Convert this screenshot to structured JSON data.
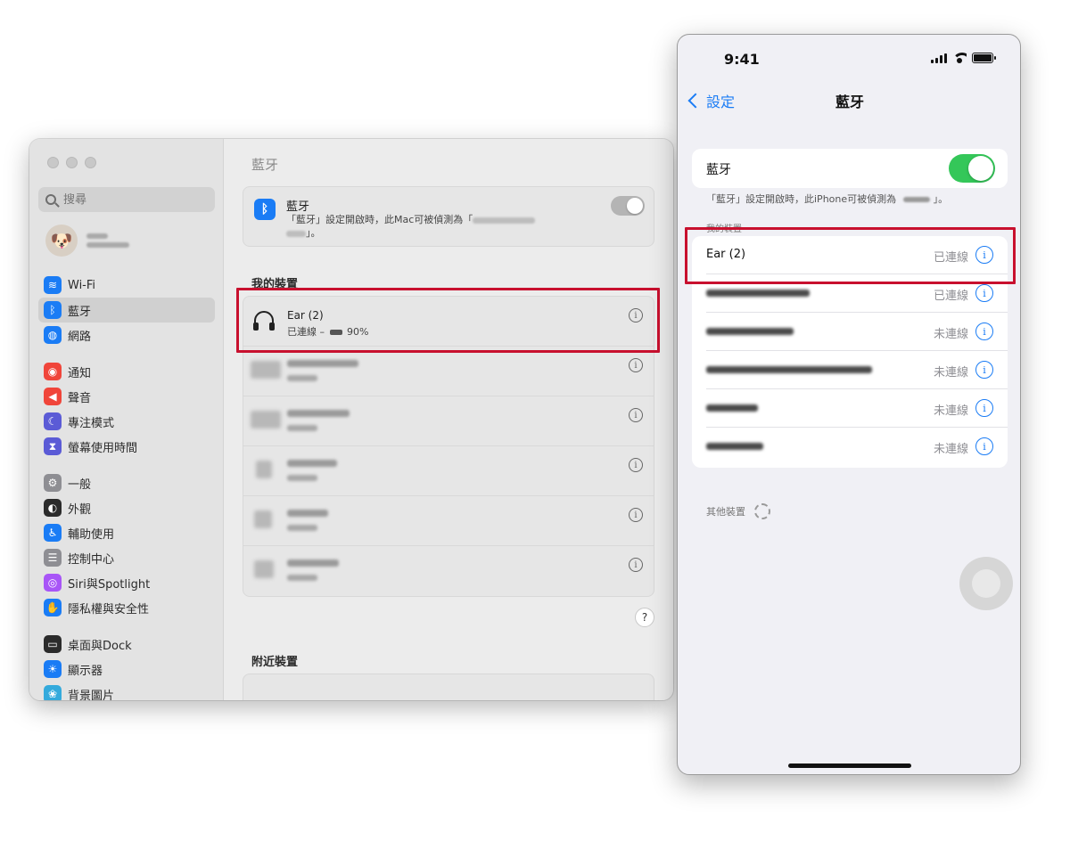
{
  "mac": {
    "search_placeholder": "搜尋",
    "sidebar": [
      {
        "label": "Wi-Fi",
        "color": "#1a7cf5",
        "glyph": "≋"
      },
      {
        "label": "藍牙",
        "color": "#1a7cf5",
        "glyph": "ᛒ",
        "active": true
      },
      {
        "label": "網路",
        "color": "#1a7cf5",
        "glyph": "◍"
      },
      {
        "label": "通知",
        "color": "#f0453a",
        "glyph": "◉"
      },
      {
        "label": "聲音",
        "color": "#f0453a",
        "glyph": "◀"
      },
      {
        "label": "專注模式",
        "color": "#5b5bd6",
        "glyph": "☾"
      },
      {
        "label": "螢幕使用時間",
        "color": "#5b5bd6",
        "glyph": "⧗"
      },
      {
        "label": "一般",
        "color": "#8e8e93",
        "glyph": "⚙"
      },
      {
        "label": "外觀",
        "color": "#2b2b2b",
        "glyph": "◐"
      },
      {
        "label": "輔助使用",
        "color": "#1a7cf5",
        "glyph": "♿"
      },
      {
        "label": "控制中心",
        "color": "#8e8e93",
        "glyph": "☰"
      },
      {
        "label": "Siri與Spotlight",
        "color": "#a855f7",
        "glyph": "◎"
      },
      {
        "label": "隱私權與安全性",
        "color": "#1a7cf5",
        "glyph": "✋"
      },
      {
        "label": "桌面與Dock",
        "color": "#2b2b2b",
        "glyph": "▭"
      },
      {
        "label": "顯示器",
        "color": "#1a7cf5",
        "glyph": "☀"
      },
      {
        "label": "背景圖片",
        "color": "#34aadc",
        "glyph": "❀"
      }
    ],
    "title": "藍牙",
    "bluetooth": {
      "name": "藍牙",
      "desc_prefix": "「藍牙」設定開啟時，此Mac可被偵測為「",
      "desc_suffix": "」。"
    },
    "my_devices_label": "我的裝置",
    "connected_device": {
      "name": "Ear (2)",
      "status": "已連線 –",
      "battery": "90%"
    },
    "info_glyph": "i",
    "help_glyph": "?",
    "nearby_label": "附近裝置"
  },
  "iphone": {
    "time": "9:41",
    "back_label": "設定",
    "title": "藍牙",
    "bluetooth_label": "藍牙",
    "note_prefix": "「藍牙」設定開啟時，此iPhone可被偵測為",
    "note_suffix": "」。",
    "my_devices_label": "我的裝置",
    "devices": [
      {
        "name": "Ear (2)",
        "status": "已連線"
      },
      {
        "name": "",
        "status": "已連線"
      },
      {
        "name": "",
        "status": "未連線"
      },
      {
        "name": "",
        "status": "未連線"
      },
      {
        "name": "",
        "status": "未連線"
      },
      {
        "name": "",
        "status": "未連線"
      }
    ],
    "other_devices_label": "其他裝置",
    "info_glyph": "i"
  },
  "colors": {
    "highlight": "#c8102e",
    "ios_blue": "#1a7cf5",
    "ios_green": "#34c759"
  }
}
